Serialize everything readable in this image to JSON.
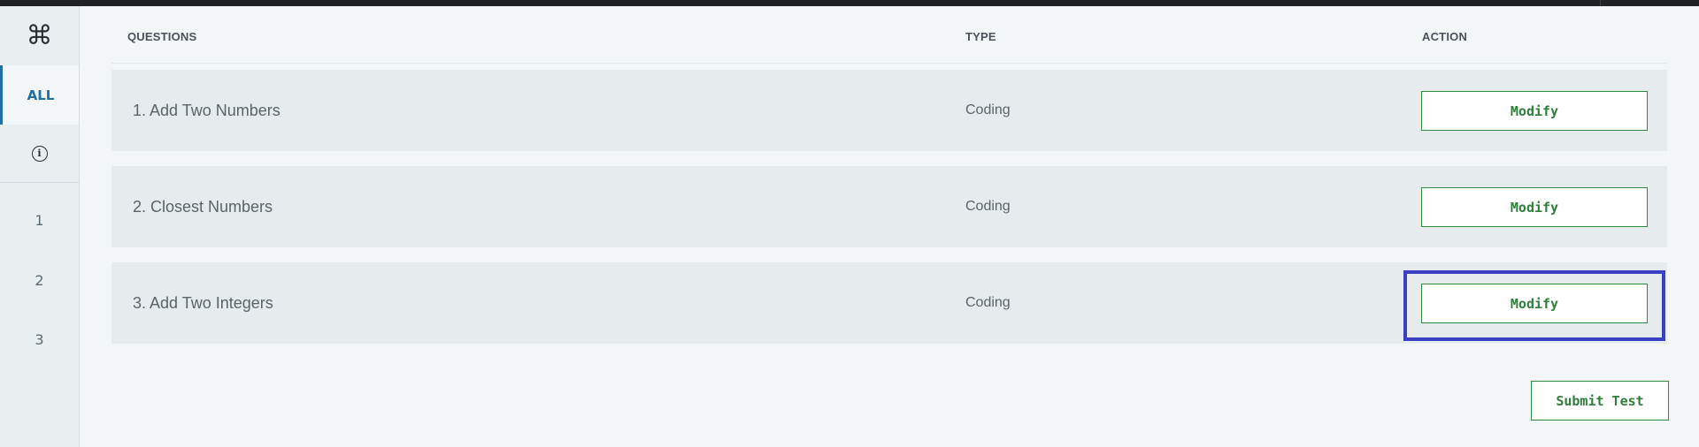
{
  "sidebar": {
    "command_icon": "⌘",
    "all_label": "ALL",
    "info_icon": "i",
    "numbers": [
      "1",
      "2",
      "3"
    ]
  },
  "table": {
    "headers": {
      "questions": "QUESTIONS",
      "type": "TYPE",
      "action": "ACTION"
    },
    "rows": [
      {
        "title": "1. Add Two Numbers",
        "type": "Coding",
        "action": "Modify"
      },
      {
        "title": "2. Closest Numbers",
        "type": "Coding",
        "action": "Modify"
      },
      {
        "title": "3. Add Two Integers",
        "type": "Coding",
        "action": "Modify"
      }
    ]
  },
  "submit_label": "Submit Test",
  "colors": {
    "accent_blue": "#1f6fa0",
    "button_green": "#2e7d3a",
    "highlight": "#3a3fc4"
  }
}
